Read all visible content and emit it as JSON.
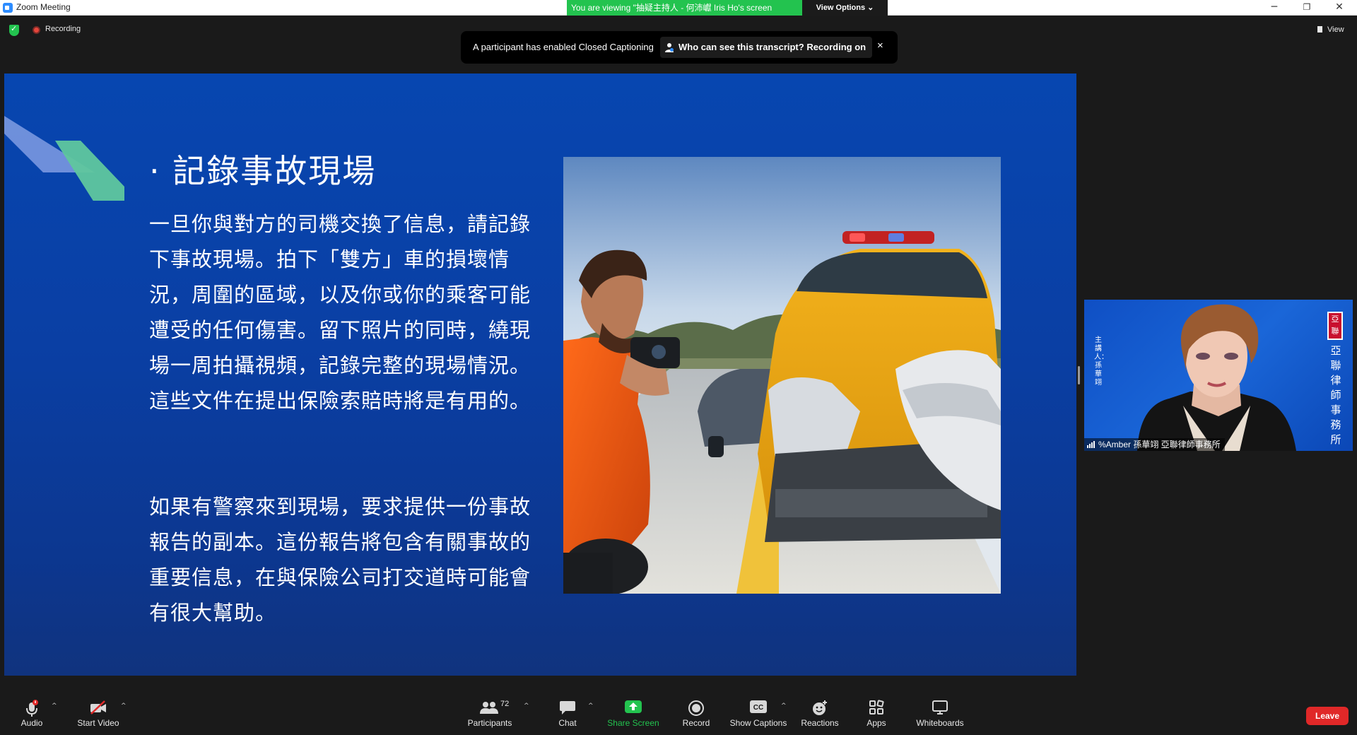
{
  "window": {
    "title": "Zoom Meeting",
    "viewing_banner": "You are viewing \"抽疑主持人 - 何沛巘 Iris Ho's screen",
    "view_options": "View Options ⌄",
    "minimize": "─",
    "restore": "❐",
    "close": "✕"
  },
  "status": {
    "recording_label": "Recording",
    "view_label": "View"
  },
  "caption_toast": {
    "message": "A participant has enabled Closed Captioning",
    "who_link": "Who can see this transcript? Recording on",
    "close": "×"
  },
  "slide": {
    "heading": "· 記錄事故現場",
    "paragraph_1": "一旦你與對方的司機交換了信息，請記錄下事故現場。拍下「雙方」車的損壞情況，周圍的區域，以及你或你的乘客可能遭受的任何傷害。留下照片的同時，繞現場一周拍攝視頻，記錄完整的現場情況。這些文件在提出保險索賠時將是有用的。",
    "paragraph_2": "如果有警察來到現場，要求提供一份事故報告的副本。這份報告將包含有關事故的重要信息，在與保險公司打交道時可能會有很大幫助。",
    "photo": "man-photographing-crashed-taxi"
  },
  "participant": {
    "name": "%Amber 孫華翊 亞聯律師事務所",
    "left_vertical_text": "主講人：孫華翊",
    "seal_text": "亞聯",
    "right_vertical_text": "亞聯律師事務所"
  },
  "toolbar": {
    "audio": "Audio",
    "start_video": "Start Video",
    "participants": "Participants",
    "participants_count": "72",
    "chat": "Chat",
    "share_screen": "Share Screen",
    "record": "Record",
    "show_captions": "Show Captions",
    "reactions": "Reactions",
    "apps": "Apps",
    "whiteboards": "Whiteboards",
    "leave": "Leave",
    "caret": "^"
  },
  "colors": {
    "accent_green": "#23c34f",
    "leave_red": "#e02828",
    "slide_blue": "#0a3fa4"
  }
}
